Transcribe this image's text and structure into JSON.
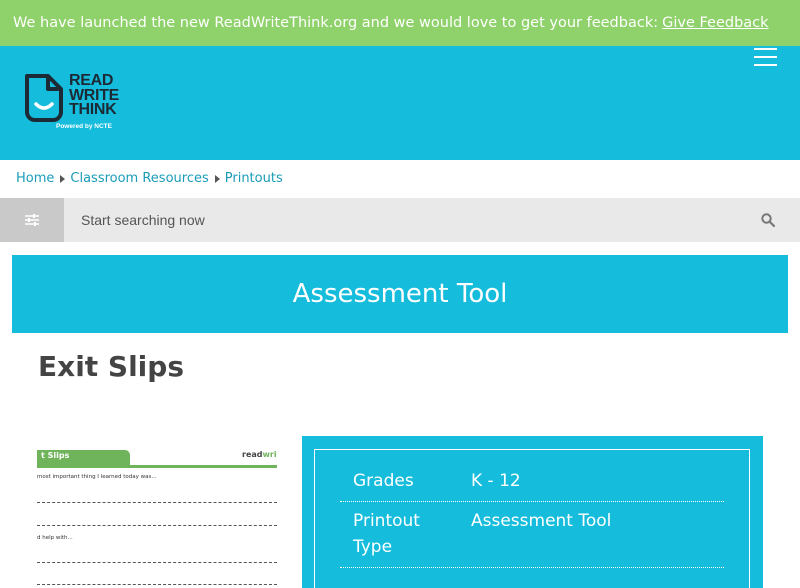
{
  "banner": {
    "text": "We have launched the new ReadWriteThink.org and we would love to get your feedback:",
    "link": "Give Feedback"
  },
  "logo": {
    "line1": "READ",
    "line2": "WRITE",
    "line3": "THINK",
    "tagline": "Powered by NCTE"
  },
  "breadcrumb": [
    "Home",
    "Classroom Resources",
    "Printouts"
  ],
  "search": {
    "placeholder": "Start searching now"
  },
  "resource_type": "Assessment Tool",
  "title": "Exit Slips",
  "thumbnail": {
    "tab_label": "t Slips",
    "brand_read": "read",
    "brand_write": "write",
    "prompt1": "most important thing I learned today was...",
    "prompt2": "d help with..."
  },
  "details": [
    {
      "label": "Grades",
      "value": "K - 12"
    },
    {
      "label": "Printout Type",
      "value": "Assessment Tool"
    }
  ],
  "colors": {
    "banner_green": "#8fd16a",
    "brand_cyan": "#15bcdc",
    "link": "#1a9cb8"
  }
}
